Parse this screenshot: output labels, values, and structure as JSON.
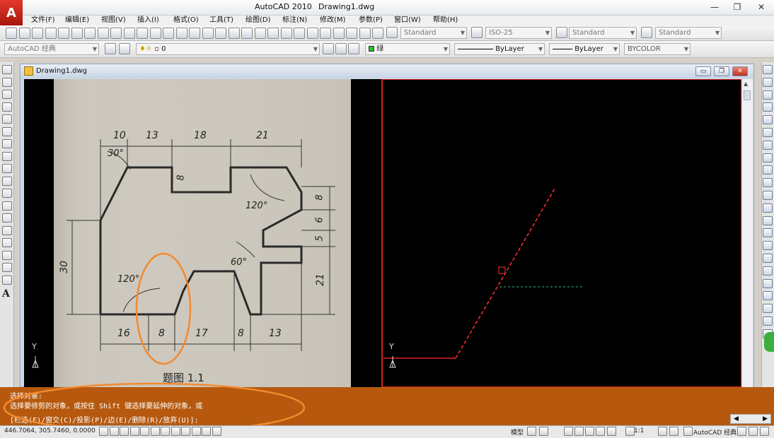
{
  "window": {
    "app_name": "AutoCAD 2010",
    "document": "Drawing1.dwg",
    "controls": {
      "minimize": "—",
      "restore": "❐",
      "close": "✕"
    }
  },
  "menu": [
    "文件(F)",
    "编辑(E)",
    "视图(V)",
    "插入(I)",
    "格式(O)",
    "工具(T)",
    "绘图(D)",
    "标注(N)",
    "修改(M)",
    "参数(P)",
    "窗口(W)",
    "帮助(H)"
  ],
  "styles_toolbar": {
    "text_style": "Standard",
    "dim_style": "ISO-25",
    "table_style": "Standard",
    "multileader_style": "Standard"
  },
  "layers_toolbar": {
    "workspace": "AutoCAD 经典",
    "layer": "0",
    "color": "绿",
    "linetype": "ByLayer",
    "lineweight": "ByLayer",
    "plotstyle": "BYCOLOR"
  },
  "drawing_window": {
    "title": "Drawing1.dwg",
    "ucs_label": "Y",
    "controls": {
      "minimize": "▭",
      "restore": "❐",
      "close": "✕"
    }
  },
  "reference_image": {
    "dims_top": [
      "10",
      "13",
      "18",
      "21"
    ],
    "dims_bottom": [
      "16",
      "8",
      "17",
      "8",
      "13"
    ],
    "dims_right": [
      "8",
      "6",
      "5",
      "21"
    ],
    "dim_left": "30",
    "dim_notch": "8",
    "angles": [
      "30°",
      "120°",
      "60°",
      "120°"
    ],
    "caption": "题图 1.1"
  },
  "command": {
    "history_1": "选择对象:",
    "history_2": "选择要修剪的对象，或按住 Shift 键选择要延伸的对象，或",
    "prompt": "[栏选(F)/窗交(C)/投影(P)/边(E)/删除(R)/放弃(U)]:"
  },
  "statusbar": {
    "coordinates": "446.7064, 305.7460, 0.0000",
    "model": "模型",
    "scale": "1:1",
    "workspace": "AutoCAD 经典"
  },
  "colors": {
    "command_bg": "#b6590e",
    "drawing_line": "#ff3030",
    "highlight_circle": "#f28a2e",
    "photo_paper": "#cdc8bd"
  }
}
